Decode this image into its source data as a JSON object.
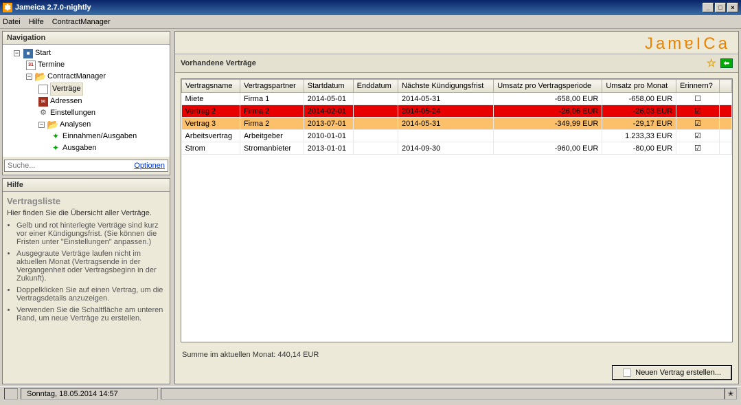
{
  "window": {
    "title": "Jameica 2.7.0-nightly"
  },
  "menubar": [
    "Datei",
    "Hilfe",
    "ContractManager"
  ],
  "nav": {
    "title": "Navigation",
    "tree": {
      "start": "Start",
      "termine": "Termine",
      "cm": "ContractManager",
      "vertraege": "Verträge",
      "adressen": "Adressen",
      "einstellungen": "Einstellungen",
      "analysen": "Analysen",
      "einaus": "Einnahmen/Ausgaben",
      "ausgaben": "Ausgaben"
    },
    "search_placeholder": "Suche...",
    "search_options": "Optionen"
  },
  "help": {
    "title": "Hilfe",
    "section": "Vertragsliste",
    "intro": "Hier finden Sie die Übersicht aller Verträge.",
    "points": [
      "Gelb und rot hinterlegte Verträge sind kurz vor einer Kündigungsfrist. (Sie können die Fristen unter \"Einstellungen\" anpassen.)",
      "Ausgegraute Verträge laufen nicht im aktuellen Monat (Vertragsende in der Vergangenheit oder Vertragsbeginn in der Zukunft).",
      "Doppelklicken Sie auf einen Vertrag, um die Vertragsdetails anzuzeigen.",
      "Verwenden Sie die Schaltfläche am unteren Rand, um neue Verträge zu erstellen."
    ]
  },
  "main": {
    "brand": "JamɐICa",
    "section_title": "Vorhandene Verträge",
    "columns": [
      "Vertragsname",
      "Vertragspartner",
      "Startdatum",
      "Enddatum",
      "Nächste Kündigungsfrist",
      "Umsatz pro Vertragsperiode",
      "Umsatz pro Monat",
      "Erinnern?"
    ],
    "rows": [
      {
        "hl": "",
        "name": "Miete",
        "partner": "Firma 1",
        "start": "2014-05-01",
        "end": "",
        "kfrist": "2014-05-31",
        "up": "-658,00 EUR",
        "um": "-658,00 EUR",
        "rem": "☐"
      },
      {
        "hl": "red",
        "name": "Vertrag 2",
        "partner": "Firma 2",
        "start": "2014-02-01",
        "end": "",
        "kfrist": "2014-05-24",
        "up": "-26,06 EUR",
        "um": "-26,03 EUR",
        "rem": "☑"
      },
      {
        "hl": "oran",
        "name": "Vertrag 3",
        "partner": "Firma 2",
        "start": "2013-07-01",
        "end": "",
        "kfrist": "2014-05-31",
        "up": "-349,99 EUR",
        "um": "-29,17 EUR",
        "rem": "☑"
      },
      {
        "hl": "",
        "name": "Arbeitsvertrag",
        "partner": "Arbeitgeber",
        "start": "2010-01-01",
        "end": "",
        "kfrist": "",
        "up": "",
        "um": "1.233,33 EUR",
        "rem": "☑"
      },
      {
        "hl": "",
        "name": "Strom",
        "partner": "Stromanbieter",
        "start": "2013-01-01",
        "end": "",
        "kfrist": "2014-09-30",
        "up": "-960,00 EUR",
        "um": "-80,00 EUR",
        "rem": "☑"
      }
    ],
    "summary": "Summe im aktuellen Monat: 440,14 EUR",
    "new_btn": "Neuen Vertrag erstellen..."
  },
  "statusbar": {
    "datetime": "Sonntag, 18.05.2014 14:57"
  },
  "icons": {
    "tw": "−",
    "twc": "+",
    "cal": "31"
  }
}
